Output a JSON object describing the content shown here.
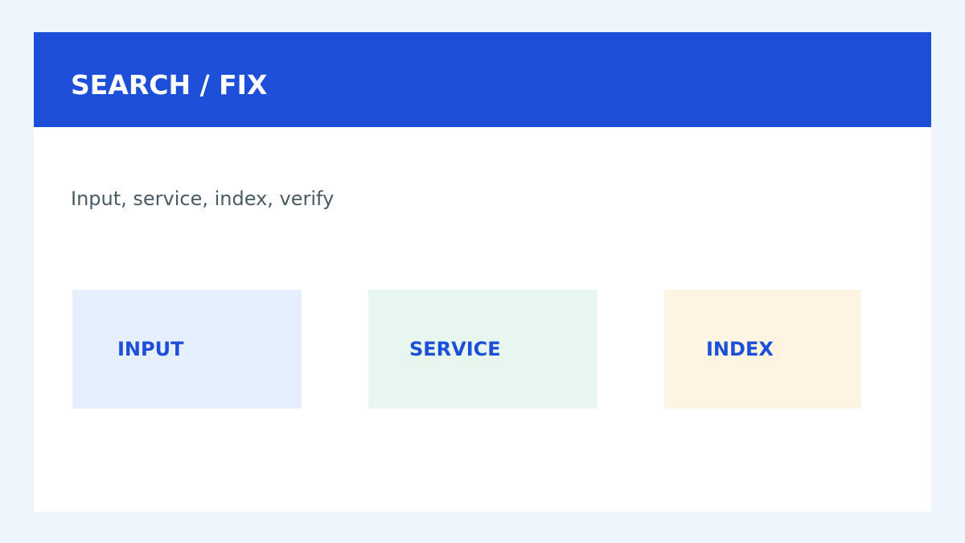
{
  "header": {
    "title": "SEARCH / FIX"
  },
  "subtitle": "Input, service, index, verify",
  "boxes": [
    {
      "label": "INPUT",
      "color": "#e6effd"
    },
    {
      "label": "SERVICE",
      "color": "#e7f6ee"
    },
    {
      "label": "INDEX",
      "color": "#fef4e2"
    }
  ],
  "colors": {
    "page_background": "#eef5fd",
    "header": "#1e4fd8",
    "label_text": "#1e4fd8",
    "subtitle_text": "#4a5a62"
  }
}
